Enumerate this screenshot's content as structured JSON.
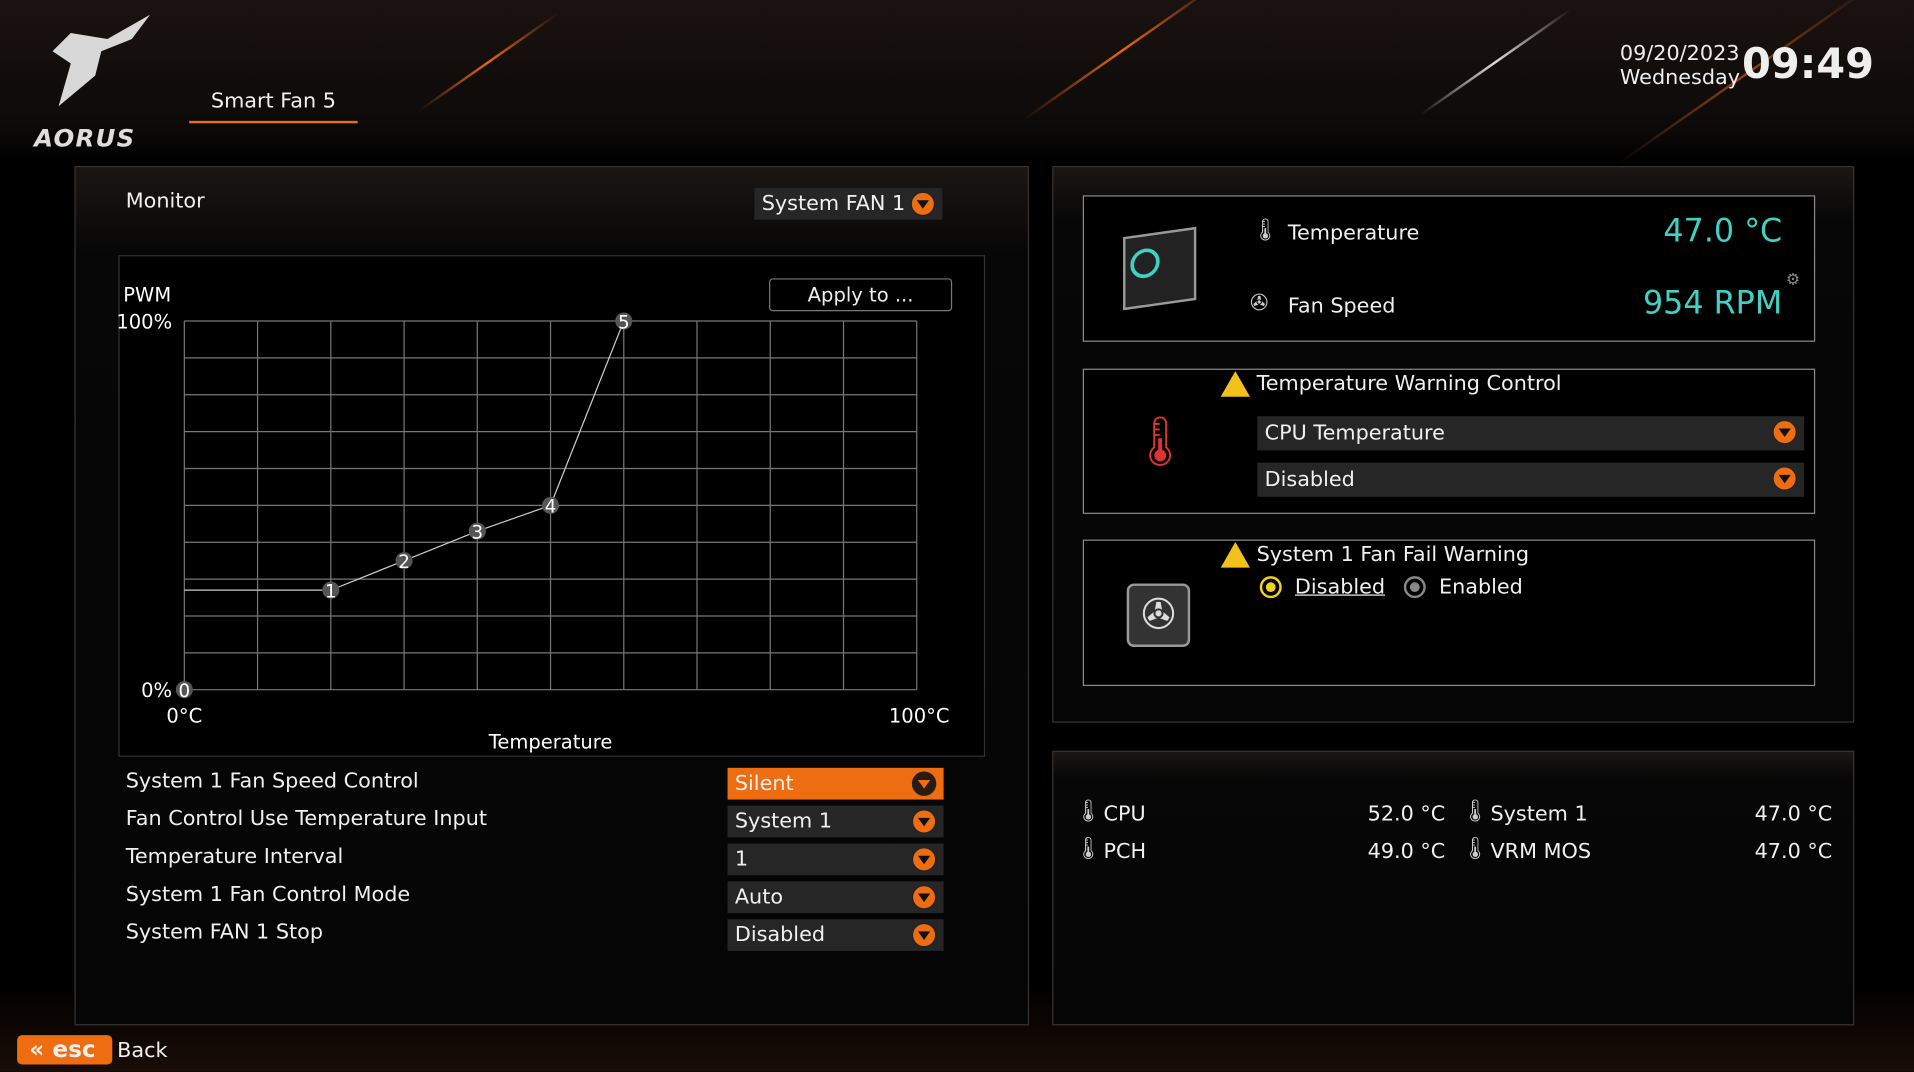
{
  "header": {
    "logo_text": "AORUS",
    "tab": "Smart Fan 5",
    "date": "09/20/2023",
    "weekday": "Wednesday",
    "time": "09:49"
  },
  "monitor": {
    "label": "Monitor",
    "fan_select": "System FAN 1",
    "apply_button": "Apply to ..."
  },
  "chart_data": {
    "type": "line",
    "ylabel": "PWM",
    "xlabel": "Temperature",
    "x_tick_labels": [
      "0°C",
      "100°C"
    ],
    "y_tick_labels": [
      "0%",
      "100%"
    ],
    "xlim": [
      0,
      100
    ],
    "ylim": [
      0,
      100
    ],
    "grid": true,
    "points": [
      {
        "label": "0",
        "x": 0,
        "y": 0
      },
      {
        "label": "1",
        "x": 20,
        "y": 27
      },
      {
        "label": "2",
        "x": 30,
        "y": 35
      },
      {
        "label": "3",
        "x": 40,
        "y": 43
      },
      {
        "label": "4",
        "x": 50,
        "y": 50
      },
      {
        "label": "5",
        "x": 60,
        "y": 100
      }
    ]
  },
  "settings": [
    {
      "label": "System 1 Fan Speed Control",
      "value": "Silent",
      "highlight": true
    },
    {
      "label": "Fan Control Use Temperature Input",
      "value": "System 1"
    },
    {
      "label": "Temperature Interval",
      "value": "1"
    },
    {
      "label": "System 1 Fan Control Mode",
      "value": "Auto"
    },
    {
      "label": "System FAN 1 Stop",
      "value": "Disabled"
    }
  ],
  "status": {
    "temp_label": "Temperature",
    "temp_value": "47.0 °C",
    "fan_label": "Fan Speed",
    "fan_value": "954 RPM"
  },
  "temp_warning": {
    "title": "Temperature Warning Control",
    "source": "CPU Temperature",
    "value": "Disabled"
  },
  "fan_fail": {
    "title": "System 1 Fan Fail Warning",
    "options": [
      "Disabled",
      "Enabled"
    ],
    "selected": "Disabled"
  },
  "sensors": [
    {
      "label": "CPU",
      "value": "52.0 °C"
    },
    {
      "label": "System 1",
      "value": "47.0 °C"
    },
    {
      "label": "PCH",
      "value": "49.0 °C"
    },
    {
      "label": "VRM MOS",
      "value": "47.0 °C"
    }
  ],
  "footer": {
    "esc": "esc",
    "back": "Back"
  },
  "colors": {
    "accent": "#ef6d11",
    "value_teal": "#3fd1c4",
    "warning": "#f2c21a"
  }
}
